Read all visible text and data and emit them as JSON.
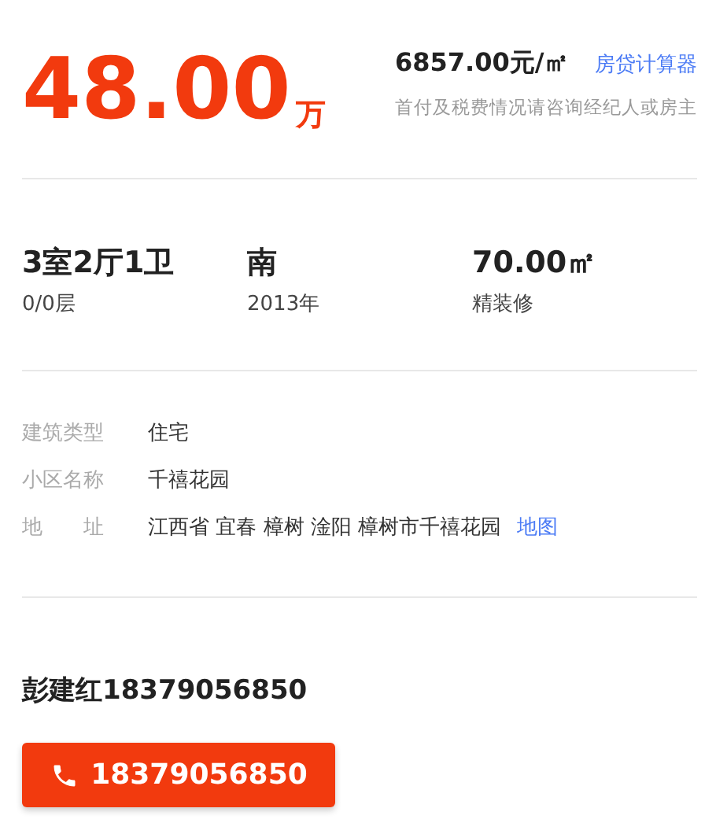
{
  "price": {
    "amount": "48.00",
    "unit": "万",
    "unit_price": "6857.00元/㎡",
    "calculator_link": "房贷计算器",
    "note": "首付及税费情况请咨询经纪人或房主"
  },
  "stats": [
    {
      "value": "3室2厅1卫",
      "label": "0/0层"
    },
    {
      "value": "南",
      "label": "2013年"
    },
    {
      "value": "70.00㎡",
      "label": "精装修"
    }
  ],
  "attributes": [
    {
      "label": "建筑类型",
      "value": "住宅"
    },
    {
      "label": "小区名称",
      "value": "千禧花园"
    },
    {
      "label": "地　　址",
      "value": "江西省 宜春 樟树 淦阳 樟树市千禧花园",
      "link": "地图"
    }
  ],
  "agent": {
    "name": "彭建红18379056850",
    "phone_button": "18379056850"
  }
}
